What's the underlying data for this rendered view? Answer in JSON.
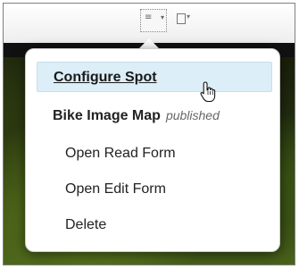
{
  "toolbar": {
    "spot_tool_icon": "spot-tool-icon",
    "box_tool_icon": "box-tool-icon"
  },
  "menu": {
    "configure_label": "Configure Spot",
    "title": "Bike Image Map",
    "status": "published",
    "items": [
      {
        "label": "Open Read Form"
      },
      {
        "label": "Open Edit Form"
      },
      {
        "label": "Delete"
      }
    ]
  },
  "colors": {
    "highlight": "#dceef7",
    "photo_dark": "#1a1f0c",
    "photo_green": "#49631a"
  }
}
